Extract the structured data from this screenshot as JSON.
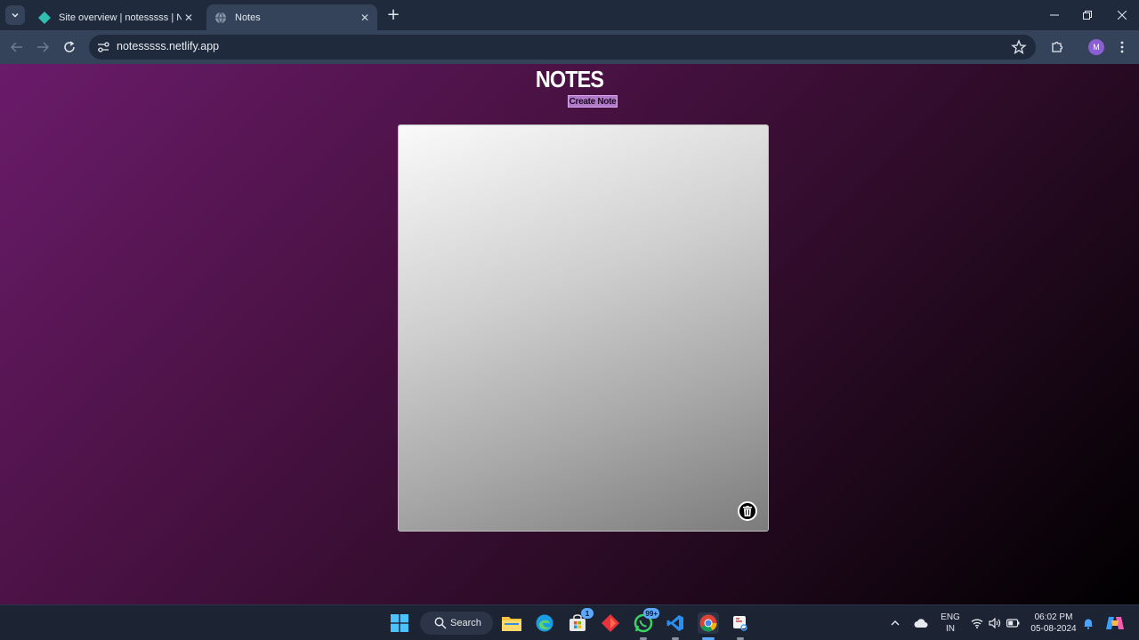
{
  "browser": {
    "tabs": [
      {
        "title": "Site overview | notesssss | Netlify",
        "active": false,
        "favicon": "netlify-icon"
      },
      {
        "title": "Notes",
        "active": true,
        "favicon": "globe-icon"
      }
    ],
    "new_tab_label": "+",
    "url": "notesssss.netlify.app",
    "profile_initial": "M",
    "accent": "#8a5fd1"
  },
  "page": {
    "title": "NOTES",
    "create_button_label": "Create Note",
    "note": {
      "text": "",
      "placeholder": ""
    },
    "colors": {
      "gradient_start": "#6a1b6a",
      "gradient_end": "#000000",
      "button": "#b07ac9"
    }
  },
  "taskbar": {
    "search_label": "Search",
    "store_badge": "1",
    "whatsapp_badge": "99+",
    "tray": {
      "language_top": "ENG",
      "language_bottom": "IN",
      "time": "06:02 PM",
      "date": "05-08-2024"
    }
  }
}
